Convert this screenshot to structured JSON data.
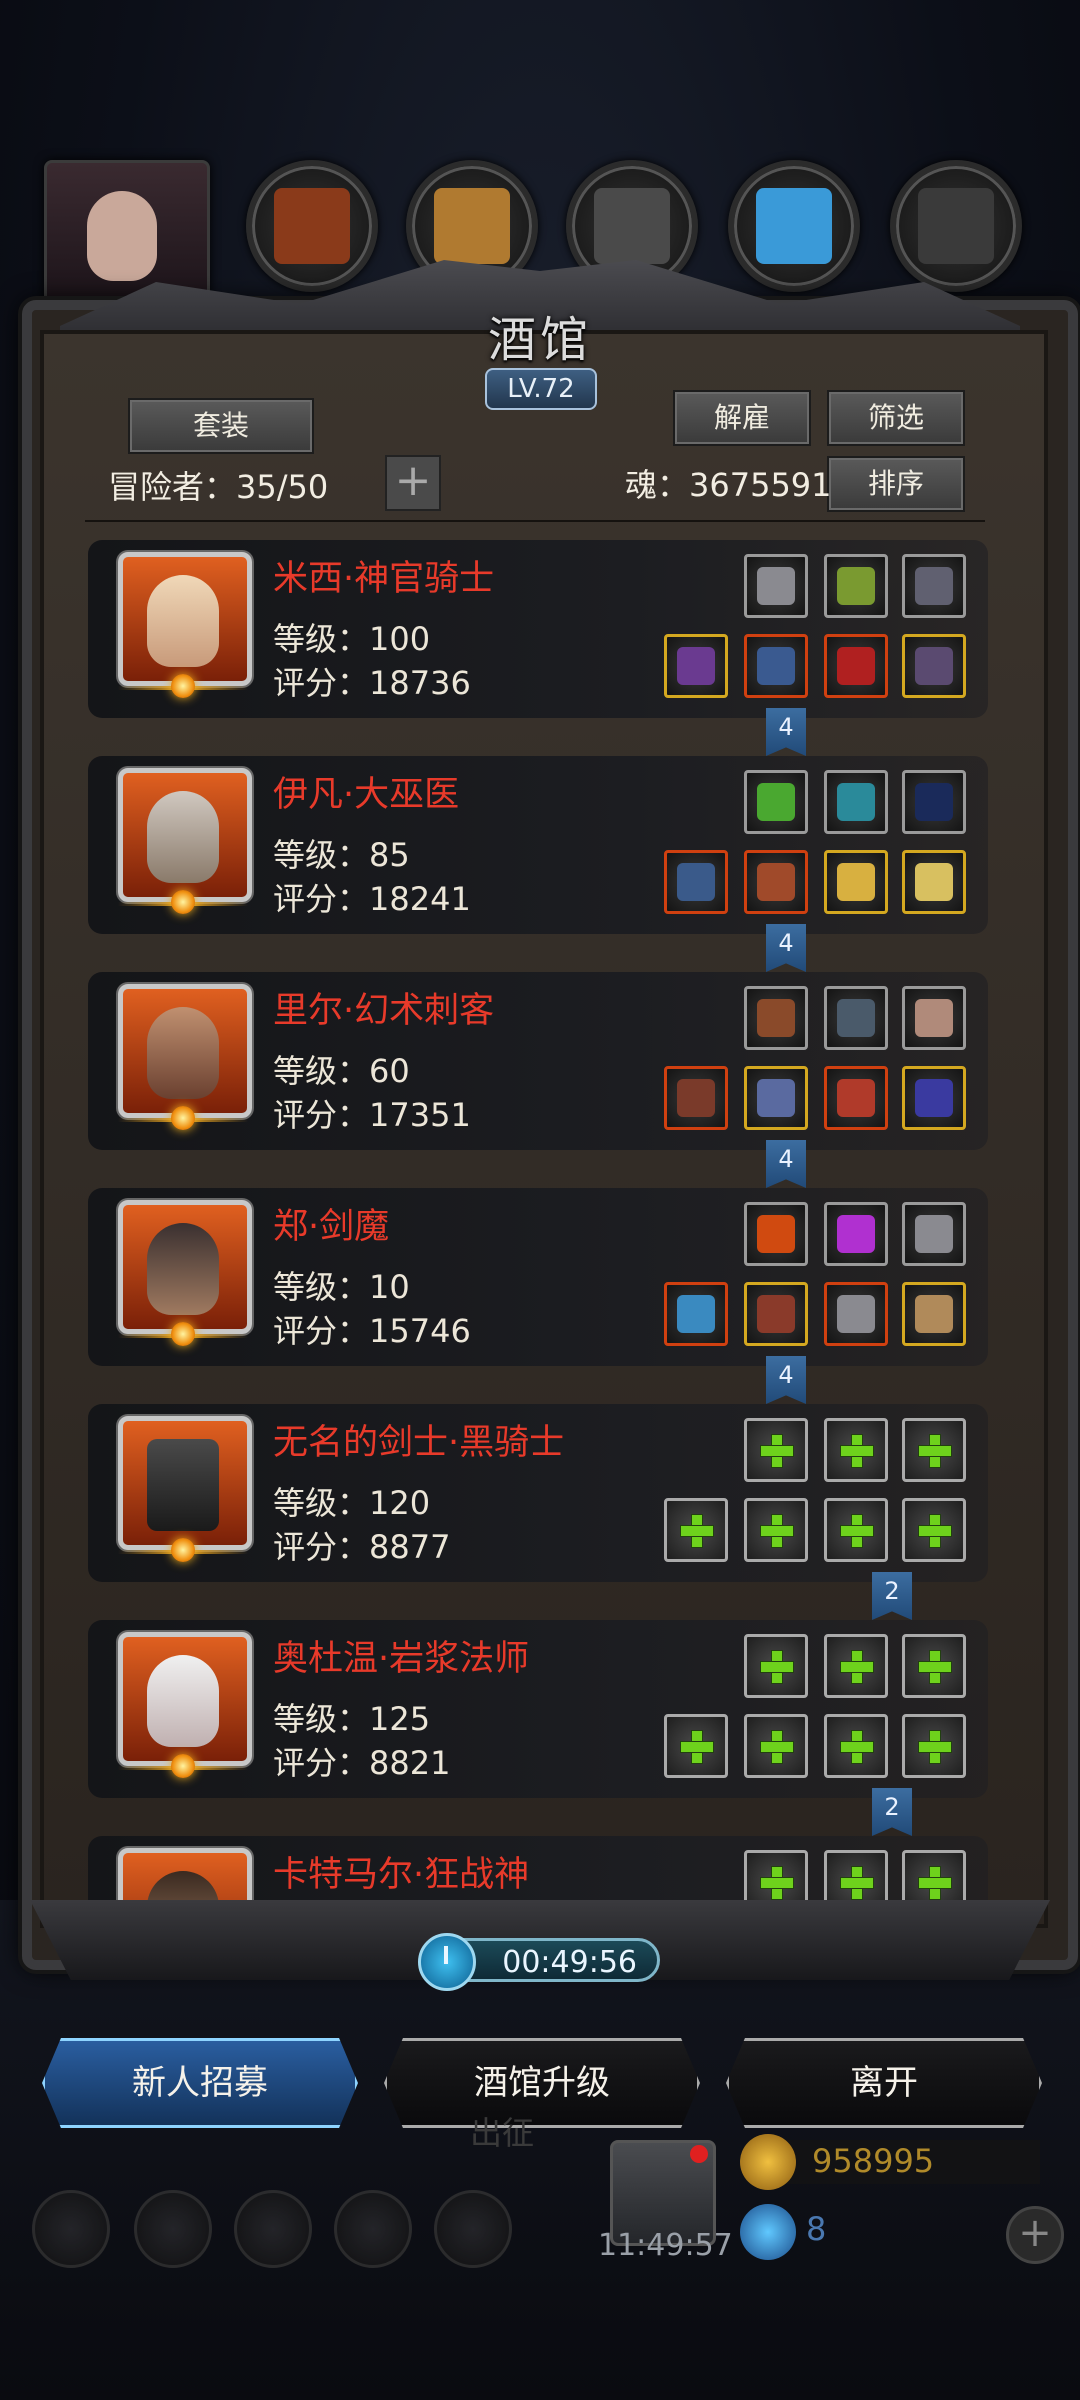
{
  "title": "酒馆",
  "level": "LV.72",
  "buttons": {
    "set": "套装",
    "dismiss": "解雇",
    "filter": "筛选",
    "sort": "排序",
    "add": "+"
  },
  "adventurers_label": "冒险者：35/50",
  "souls_label": "魂：3675591",
  "heroes": [
    {
      "name": "米西·神官骑士",
      "level": "等级：100",
      "score": "评分：18736",
      "tag": "4"
    },
    {
      "name": "伊凡·大巫医",
      "level": "等级：85",
      "score": "评分：18241",
      "tag": "4"
    },
    {
      "name": "里尔·幻术刺客",
      "level": "等级：60",
      "score": "评分：17351",
      "tag": "4"
    },
    {
      "name": "郑·剑魔",
      "level": "等级：10",
      "score": "评分：15746",
      "tag": "4"
    },
    {
      "name": "无名的剑士·黑骑士",
      "level": "等级：120",
      "score": "评分：8877",
      "tag": "2"
    },
    {
      "name": "奥杜温·岩浆法师",
      "level": "等级：125",
      "score": "评分：8821",
      "tag": "2"
    },
    {
      "name": "卡特马尔·狂战神",
      "level": "",
      "score": "",
      "tag": ""
    }
  ],
  "timer": "00:49:56",
  "actions": {
    "recruit": "新人招募",
    "upgrade": "酒馆升级",
    "leave": "离开"
  },
  "bottom": {
    "faded_text": "出征",
    "gift_time": "11:49:57",
    "gold": "958995",
    "gems": "8"
  },
  "colors": {
    "hero_name": "#e83a2a",
    "plus_green": "#6ed21c",
    "tag_blue": "#214a78"
  }
}
